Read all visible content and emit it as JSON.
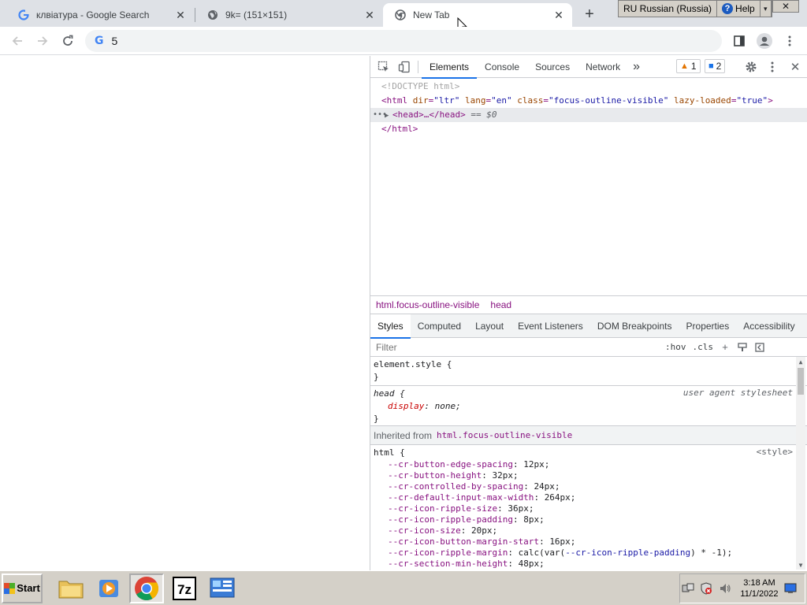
{
  "tabs": [
    {
      "title": "клвіатура - Google Search",
      "icon": "google-icon",
      "active": false
    },
    {
      "title": "9k= (151×151)",
      "icon": "globe-icon",
      "active": false
    },
    {
      "title": "New Tab",
      "icon": "chrome-icon",
      "active": true
    }
  ],
  "new_tab_glyph": "+",
  "langbar": {
    "language": "RU Russian (Russia)",
    "help": "Help"
  },
  "toolbar": {
    "omnibox_text": "5",
    "omnibox_icon": "G"
  },
  "devtools": {
    "tabs": [
      "Elements",
      "Console",
      "Sources",
      "Network"
    ],
    "more": "»",
    "warnings": "1",
    "messages": "2",
    "tree": {
      "doctype": "<!DOCTYPE html>",
      "html_open_tag": "<html",
      "attr_dir": "dir",
      "val_dir": "\"ltr\"",
      "attr_lang": "lang",
      "val_lang": "\"en\"",
      "attr_class": "class",
      "val_class": "\"focus-outline-visible\"",
      "attr_lazy": "lazy-loaded",
      "val_lazy": "\"true\"",
      "html_open_end": ">",
      "head_collapsed": "<head>…</head>",
      "selected_marker": "== $0",
      "html_close": "</html>",
      "dots": "•••"
    },
    "breadcrumbs": [
      "html.focus-outline-visible",
      "head"
    ],
    "subtabs": [
      "Styles",
      "Computed",
      "Layout",
      "Event Listeners",
      "DOM Breakpoints",
      "Properties",
      "Accessibility"
    ],
    "filter": {
      "placeholder": "Filter",
      "hov": ":hov",
      "cls": ".cls"
    },
    "styles": {
      "element_style": "element.style {",
      "close_brace": "}",
      "head_rule": "head {",
      "head_origin": "user agent stylesheet",
      "head_prop": "display",
      "head_val": "none;",
      "inherited_label": "Inherited from",
      "inherited_selector": "html.focus-outline-visible",
      "html_rule": "html {",
      "html_origin": "<style>",
      "vars": [
        {
          "name": "--cr-button-edge-spacing",
          "value": "12px;"
        },
        {
          "name": "--cr-button-height",
          "value": "32px;"
        },
        {
          "name": "--cr-controlled-by-spacing",
          "value": "24px;"
        },
        {
          "name": "--cr-default-input-max-width",
          "value": "264px;"
        },
        {
          "name": "--cr-icon-ripple-size",
          "value": "36px;"
        },
        {
          "name": "--cr-icon-ripple-padding",
          "value": "8px;"
        },
        {
          "name": "--cr-icon-size",
          "value": "20px;"
        },
        {
          "name": "--cr-icon-button-margin-start",
          "value": "16px;"
        }
      ],
      "ripple_margin_name": "--cr-icon-ripple-margin",
      "ripple_margin_pre": "calc(var(",
      "ripple_margin_ref": "--cr-icon-ripple-padding",
      "ripple_margin_post": ") * -1);",
      "section_min_height_name": "--cr-section-min-height",
      "section_min_height_val": "48px;"
    }
  },
  "taskbar": {
    "start": "Start",
    "clock_time": "3:18 AM",
    "clock_date": "11/1/2022"
  },
  "colors": {
    "accent": "#1a73e8",
    "tag": "#881280",
    "attr": "#994500",
    "value": "#1a1aa6"
  }
}
